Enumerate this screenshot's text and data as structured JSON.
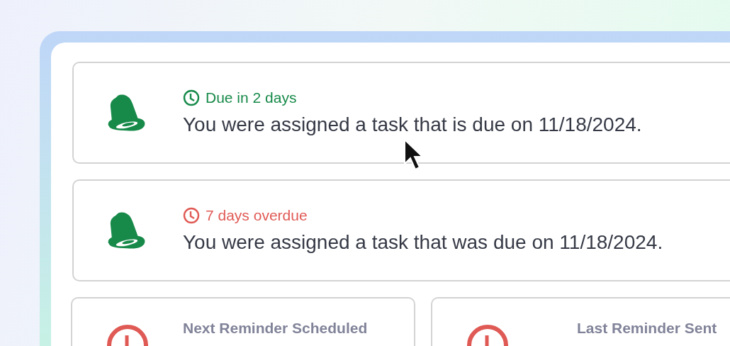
{
  "notifications": [
    {
      "status": "Due in 2 days",
      "color": "#178a4a",
      "message": "You were assigned a task that is due on 11/18/2024."
    },
    {
      "status": "7 days overdue",
      "color": "#e05a55",
      "message": "You were assigned a task that was due on 11/18/2024."
    }
  ],
  "reminders": [
    {
      "title": "Next Reminder Scheduled"
    },
    {
      "title": "Last Reminder Sent"
    }
  ]
}
